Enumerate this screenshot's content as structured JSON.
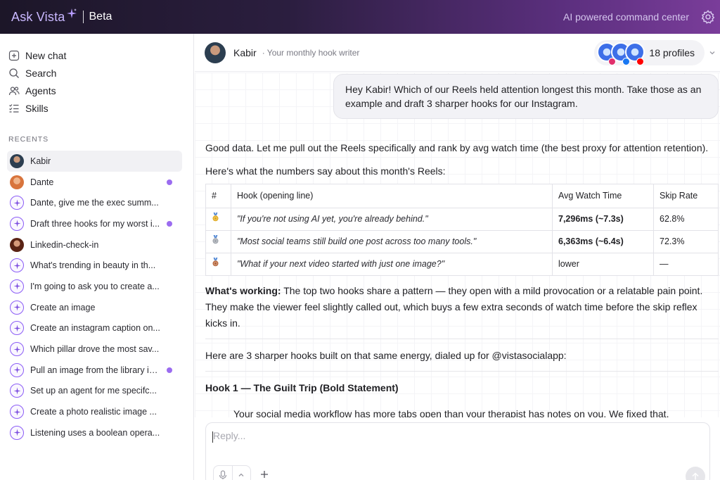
{
  "header": {
    "brand": "Ask Vista",
    "beta": "Beta",
    "tagline": "AI powered command center"
  },
  "sidebar": {
    "nav": [
      {
        "label": "New chat",
        "icon": "plus-square-icon"
      },
      {
        "label": "Search",
        "icon": "search-icon"
      },
      {
        "label": "Agents",
        "icon": "users-icon"
      },
      {
        "label": "Skills",
        "icon": "checklist-icon"
      }
    ],
    "recents_title": "RECENTS",
    "recents": [
      {
        "label": "Kabir",
        "avatar": "kabir",
        "active": true,
        "unread": false
      },
      {
        "label": "Dante",
        "avatar": "dante",
        "active": false,
        "unread": true
      },
      {
        "label": "Dante, give me the exec summ...",
        "avatar": "sparkle",
        "active": false,
        "unread": false
      },
      {
        "label": "Draft three hooks for my worst i...",
        "avatar": "sparkle",
        "active": false,
        "unread": true
      },
      {
        "label": "Linkedin-check-in",
        "avatar": "linkedin",
        "active": false,
        "unread": false
      },
      {
        "label": "What's trending in beauty in th...",
        "avatar": "sparkle",
        "active": false,
        "unread": false
      },
      {
        "label": "I'm going to ask you to create a...",
        "avatar": "sparkle",
        "active": false,
        "unread": false
      },
      {
        "label": "Create an image",
        "avatar": "sparkle",
        "active": false,
        "unread": false
      },
      {
        "label": "Create an instagram caption on...",
        "avatar": "sparkle",
        "active": false,
        "unread": false
      },
      {
        "label": "Which pillar drove the most sav...",
        "avatar": "sparkle",
        "active": false,
        "unread": false
      },
      {
        "label": "Pull an image from the library in...",
        "avatar": "sparkle",
        "active": false,
        "unread": true
      },
      {
        "label": "Set up an agent for me specifc...",
        "avatar": "sparkle",
        "active": false,
        "unread": false
      },
      {
        "label": "Create a photo realistic image ...",
        "avatar": "sparkle",
        "active": false,
        "unread": false
      },
      {
        "label": "Listening uses a boolean opera...",
        "avatar": "sparkle",
        "active": false,
        "unread": false
      }
    ]
  },
  "chat": {
    "agent_name": "Kabir",
    "agent_role": "· Your monthly hook writer",
    "profiles_label": "18 profiles",
    "user_message": "Hey Kabir! Which of our Reels held attention longest this month. Take those as an example and draft 3 sharper hooks for our Instagram.",
    "reply_intro": "Good data. Let me pull out the Reels specifically and rank by avg watch time (the best proxy for attention retention).",
    "reply_lead": "Here's what the numbers say about this month's Reels:",
    "table": {
      "headers": [
        "#",
        "Hook (opening line)",
        "Avg Watch Time",
        "Skip Rate"
      ],
      "rows": [
        {
          "rank": "gold-medal-icon",
          "hook": "\"If you're not using AI yet, you're already behind.\"",
          "watch": "7,296ms (~7.3s)",
          "skip": "62.8%",
          "bold": true
        },
        {
          "rank": "silver-medal-icon",
          "hook": "\"Most social teams still build one post across too many tools.\"",
          "watch": "6,363ms (~6.4s)",
          "skip": "72.3%",
          "bold": true
        },
        {
          "rank": "bronze-medal-icon",
          "hook": "\"What if your next video started with just one image?\"",
          "watch": "lower",
          "skip": "—",
          "bold": false
        }
      ]
    },
    "working_label": "What's working:",
    "working_text": " The top two hooks share a pattern — they open with a mild provocation or a relatable pain point. They make the viewer feel slightly called out, which buys a few extra seconds of watch time before the skip reflex kicks in.",
    "hooks_intro": "Here are 3 sharper hooks built on that same energy, dialed up for @vistasocialapp:",
    "hook1_title": "Hook 1 — The Guilt Trip (Bold Statement)",
    "hook1_text": "Your social media workflow has more tabs open than your therapist has notes on you. We fixed that."
  },
  "composer": {
    "placeholder": "Reply..."
  },
  "colors": {
    "accent": "#8b5cf6",
    "unread_dot": "#9b6cf0",
    "header_start": "#1c1628",
    "header_end": "#7a3d9a"
  }
}
